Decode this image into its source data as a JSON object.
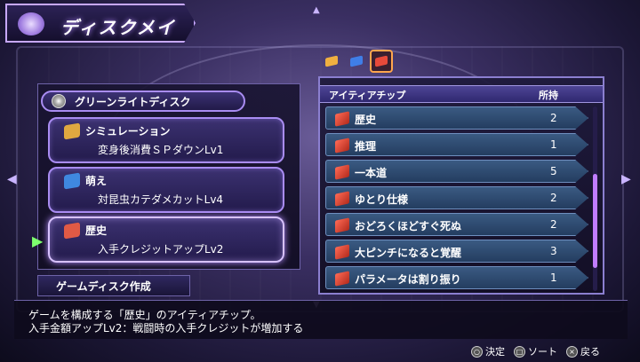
{
  "header": {
    "title": "ディスクメイク"
  },
  "disc": {
    "name": "グリーンライトディスク"
  },
  "slots": [
    {
      "name": "シミュレーション",
      "effect": "変身後消費ＳＰダウンLv1",
      "color": "#e0a840"
    },
    {
      "name": "萌え",
      "effect": "対昆虫カテダメカットLv4",
      "color": "#3f88e0"
    },
    {
      "name": "歴史",
      "effect": "入手クレジットアップLv2",
      "color": "#e05a45"
    }
  ],
  "create_button": "ゲームディスク作成",
  "color_tabs": [
    {
      "name": "yellow-chip-tab",
      "color": "#f0b040"
    },
    {
      "name": "blue-chip-tab",
      "color": "#3f7ee8"
    },
    {
      "name": "red-chip-tab",
      "color": "#e84a3a"
    }
  ],
  "chip_list": {
    "header_name": "アイティアチップ",
    "header_owned": "所持",
    "items": [
      {
        "name": "歴史",
        "qty": "2"
      },
      {
        "name": "推理",
        "qty": "1"
      },
      {
        "name": "一本道",
        "qty": "5"
      },
      {
        "name": "ゆとり仕様",
        "qty": "2"
      },
      {
        "name": "おどろくほどすぐ死ぬ",
        "qty": "2"
      },
      {
        "name": "大ピンチになると覚醒",
        "qty": "3"
      },
      {
        "name": "パラメータは割り振り",
        "qty": "1"
      }
    ]
  },
  "description": {
    "line1": "ゲームを構成する「歴史」のアイティアチップ。",
    "line2": "入手金額アップLv2：戦闘時の入手クレジットが増加する"
  },
  "controls": [
    {
      "glyph": "○",
      "label": "決定"
    },
    {
      "glyph": "□",
      "label": "ソート"
    },
    {
      "glyph": "×",
      "label": "戻る"
    }
  ]
}
